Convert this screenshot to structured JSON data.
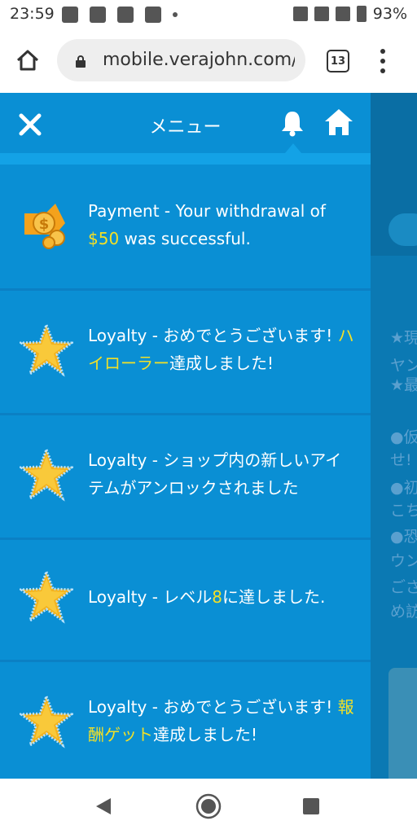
{
  "status_bar": {
    "time": "23:59",
    "battery_percent": "93%",
    "icons": [
      "notification-icon",
      "cup-icon",
      "calendar-icon",
      "shield-icon",
      "dot-icon",
      "vibrate-icon",
      "wifi-icon",
      "signal-icon",
      "battery-icon"
    ]
  },
  "browser": {
    "url": "mobile.verajohn.com/ja",
    "tab_count": "13"
  },
  "menu": {
    "title": "メニュー",
    "notifications": [
      {
        "icon": "payment-coin-icon",
        "parts": [
          "Payment - Your withdrawal of ",
          "$50",
          " was successful."
        ]
      },
      {
        "icon": "star-icon",
        "parts": [
          "Loyalty - おめでとうございます! ",
          "ハイローラー",
          "達成しました!"
        ]
      },
      {
        "icon": "star-icon",
        "parts": [
          "Loyalty - ショップ内の新しいアイテムがアンロックされました",
          "",
          ""
        ]
      },
      {
        "icon": "star-icon",
        "parts": [
          "Loyalty - レベル",
          "8",
          "に達しました."
        ]
      },
      {
        "icon": "star-icon",
        "parts": [
          "Loyalty - おめでとうございます! ",
          "報酬ゲット",
          "達成しました!"
        ]
      }
    ]
  },
  "background_page": {
    "lines": [
      "★現",
      "ヤン",
      "★最",
      "●仮",
      "せ!",
      "●初",
      "こち",
      "●恐",
      "ウン",
      "ござ",
      "め訪"
    ]
  },
  "colors": {
    "menu_bg": "#0a8fd4",
    "highlight": "#f2e027",
    "divider": "#0b80c4"
  }
}
